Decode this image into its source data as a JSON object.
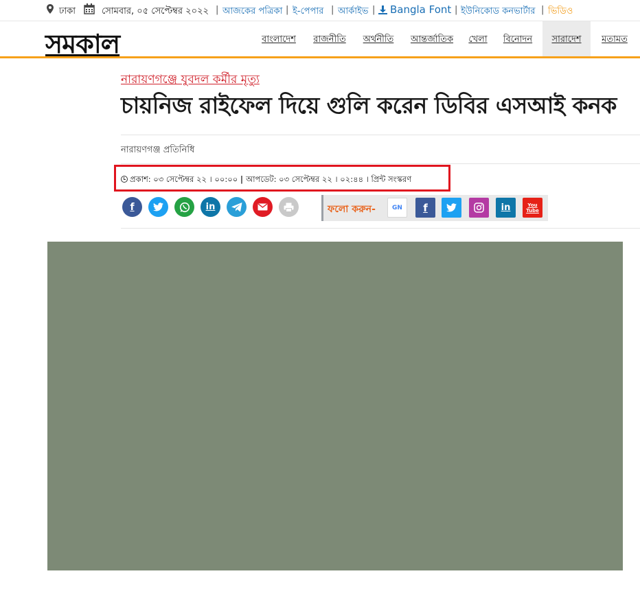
{
  "topbar": {
    "location": "ঢাকা",
    "date": "সোমবার, ০৫ সেপ্টেম্বর ২০২২",
    "links": [
      "আজকের পত্রিকা",
      "ই-পেপার",
      "আর্কাইভ",
      "Bangla Font",
      "ইউনিকোড কনভার্টার",
      "ভিডিও"
    ],
    "icons": [
      "map-pin-icon",
      "calendar-icon",
      "download-icon"
    ]
  },
  "header": {
    "logo": "সমকাল",
    "nav": [
      "বাংলাদেশ",
      "রাজনীতি",
      "অর্থনীতি",
      "আন্তর্জাতিক",
      "খেলা",
      "বিনোদন",
      "সারাদেশ",
      "মতামত"
    ],
    "active_nav": "সারাদেশ"
  },
  "article": {
    "kicker": "নারায়ণগঞ্জে যুবদল কর্মীর মৃত্যু",
    "headline": "চায়নিজ রাইফেল দিয়ে গুলি করেন ডিবির এসআই কনক",
    "byline": "নারায়ণগঞ্জ প্রতিনিধি",
    "published": "প্রকাশ: ০৩ সেপ্টেম্বর ২২ । ০০:০০",
    "updated": "আপডেট: ০৩ সেপ্টেম্বর ২২ । ০২:৪৪",
    "print": "প্রিন্ট সংস্করণ"
  },
  "share": {
    "icons": [
      "facebook-icon",
      "twitter-icon",
      "whatsapp-icon",
      "linkedin-icon",
      "telegram-icon",
      "email-icon",
      "print-icon"
    ]
  },
  "follow": {
    "label": "ফলো করুন-",
    "icons": [
      "google-news-icon",
      "facebook-icon",
      "twitter-icon",
      "instagram-icon",
      "linkedin-icon",
      "youtube-icon"
    ],
    "gnews_text": "GN",
    "youtube_text": "You Tube"
  },
  "colors": {
    "brand_orange": "#f7a11a",
    "kicker_red": "#d0202a",
    "link_blue": "#1a6fb5",
    "highlight_red": "#e0141e",
    "follow_orange": "#e9621a"
  }
}
